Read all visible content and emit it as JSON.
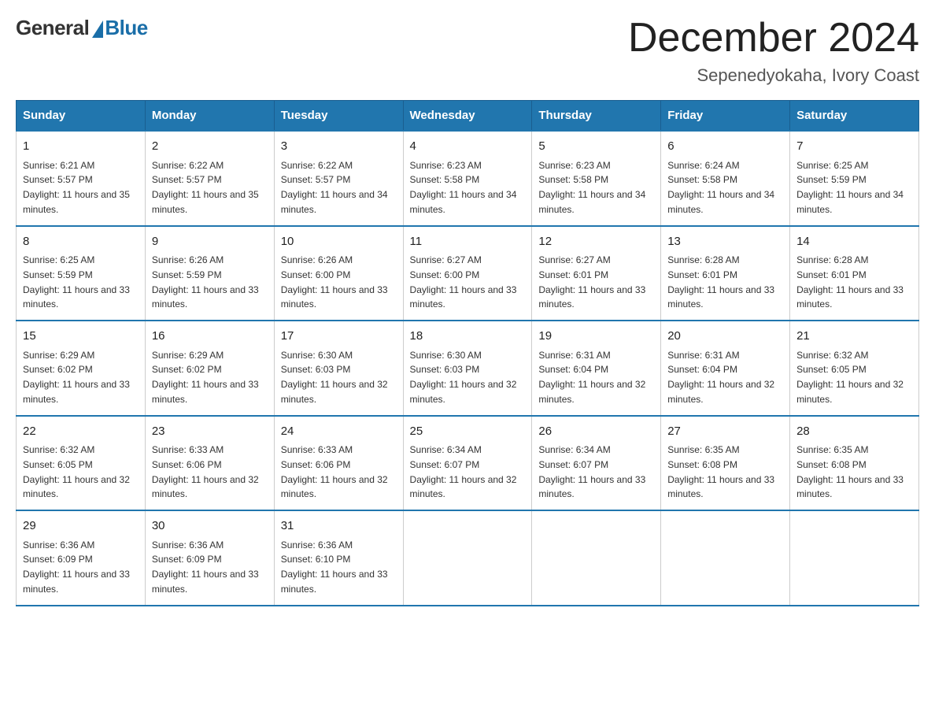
{
  "header": {
    "logo_general": "General",
    "logo_blue": "Blue",
    "month_year": "December 2024",
    "location": "Sepenedyokaha, Ivory Coast"
  },
  "weekdays": [
    "Sunday",
    "Monday",
    "Tuesday",
    "Wednesday",
    "Thursday",
    "Friday",
    "Saturday"
  ],
  "weeks": [
    [
      {
        "day": "1",
        "sunrise": "6:21 AM",
        "sunset": "5:57 PM",
        "daylight": "11 hours and 35 minutes."
      },
      {
        "day": "2",
        "sunrise": "6:22 AM",
        "sunset": "5:57 PM",
        "daylight": "11 hours and 35 minutes."
      },
      {
        "day": "3",
        "sunrise": "6:22 AM",
        "sunset": "5:57 PM",
        "daylight": "11 hours and 34 minutes."
      },
      {
        "day": "4",
        "sunrise": "6:23 AM",
        "sunset": "5:58 PM",
        "daylight": "11 hours and 34 minutes."
      },
      {
        "day": "5",
        "sunrise": "6:23 AM",
        "sunset": "5:58 PM",
        "daylight": "11 hours and 34 minutes."
      },
      {
        "day": "6",
        "sunrise": "6:24 AM",
        "sunset": "5:58 PM",
        "daylight": "11 hours and 34 minutes."
      },
      {
        "day": "7",
        "sunrise": "6:25 AM",
        "sunset": "5:59 PM",
        "daylight": "11 hours and 34 minutes."
      }
    ],
    [
      {
        "day": "8",
        "sunrise": "6:25 AM",
        "sunset": "5:59 PM",
        "daylight": "11 hours and 33 minutes."
      },
      {
        "day": "9",
        "sunrise": "6:26 AM",
        "sunset": "5:59 PM",
        "daylight": "11 hours and 33 minutes."
      },
      {
        "day": "10",
        "sunrise": "6:26 AM",
        "sunset": "6:00 PM",
        "daylight": "11 hours and 33 minutes."
      },
      {
        "day": "11",
        "sunrise": "6:27 AM",
        "sunset": "6:00 PM",
        "daylight": "11 hours and 33 minutes."
      },
      {
        "day": "12",
        "sunrise": "6:27 AM",
        "sunset": "6:01 PM",
        "daylight": "11 hours and 33 minutes."
      },
      {
        "day": "13",
        "sunrise": "6:28 AM",
        "sunset": "6:01 PM",
        "daylight": "11 hours and 33 minutes."
      },
      {
        "day": "14",
        "sunrise": "6:28 AM",
        "sunset": "6:01 PM",
        "daylight": "11 hours and 33 minutes."
      }
    ],
    [
      {
        "day": "15",
        "sunrise": "6:29 AM",
        "sunset": "6:02 PM",
        "daylight": "11 hours and 33 minutes."
      },
      {
        "day": "16",
        "sunrise": "6:29 AM",
        "sunset": "6:02 PM",
        "daylight": "11 hours and 33 minutes."
      },
      {
        "day": "17",
        "sunrise": "6:30 AM",
        "sunset": "6:03 PM",
        "daylight": "11 hours and 32 minutes."
      },
      {
        "day": "18",
        "sunrise": "6:30 AM",
        "sunset": "6:03 PM",
        "daylight": "11 hours and 32 minutes."
      },
      {
        "day": "19",
        "sunrise": "6:31 AM",
        "sunset": "6:04 PM",
        "daylight": "11 hours and 32 minutes."
      },
      {
        "day": "20",
        "sunrise": "6:31 AM",
        "sunset": "6:04 PM",
        "daylight": "11 hours and 32 minutes."
      },
      {
        "day": "21",
        "sunrise": "6:32 AM",
        "sunset": "6:05 PM",
        "daylight": "11 hours and 32 minutes."
      }
    ],
    [
      {
        "day": "22",
        "sunrise": "6:32 AM",
        "sunset": "6:05 PM",
        "daylight": "11 hours and 32 minutes."
      },
      {
        "day": "23",
        "sunrise": "6:33 AM",
        "sunset": "6:06 PM",
        "daylight": "11 hours and 32 minutes."
      },
      {
        "day": "24",
        "sunrise": "6:33 AM",
        "sunset": "6:06 PM",
        "daylight": "11 hours and 32 minutes."
      },
      {
        "day": "25",
        "sunrise": "6:34 AM",
        "sunset": "6:07 PM",
        "daylight": "11 hours and 32 minutes."
      },
      {
        "day": "26",
        "sunrise": "6:34 AM",
        "sunset": "6:07 PM",
        "daylight": "11 hours and 33 minutes."
      },
      {
        "day": "27",
        "sunrise": "6:35 AM",
        "sunset": "6:08 PM",
        "daylight": "11 hours and 33 minutes."
      },
      {
        "day": "28",
        "sunrise": "6:35 AM",
        "sunset": "6:08 PM",
        "daylight": "11 hours and 33 minutes."
      }
    ],
    [
      {
        "day": "29",
        "sunrise": "6:36 AM",
        "sunset": "6:09 PM",
        "daylight": "11 hours and 33 minutes."
      },
      {
        "day": "30",
        "sunrise": "6:36 AM",
        "sunset": "6:09 PM",
        "daylight": "11 hours and 33 minutes."
      },
      {
        "day": "31",
        "sunrise": "6:36 AM",
        "sunset": "6:10 PM",
        "daylight": "11 hours and 33 minutes."
      },
      null,
      null,
      null,
      null
    ]
  ],
  "colors": {
    "header_bg": "#2176ae",
    "header_text": "#ffffff",
    "border": "#cccccc",
    "accent_border": "#2176ae"
  }
}
